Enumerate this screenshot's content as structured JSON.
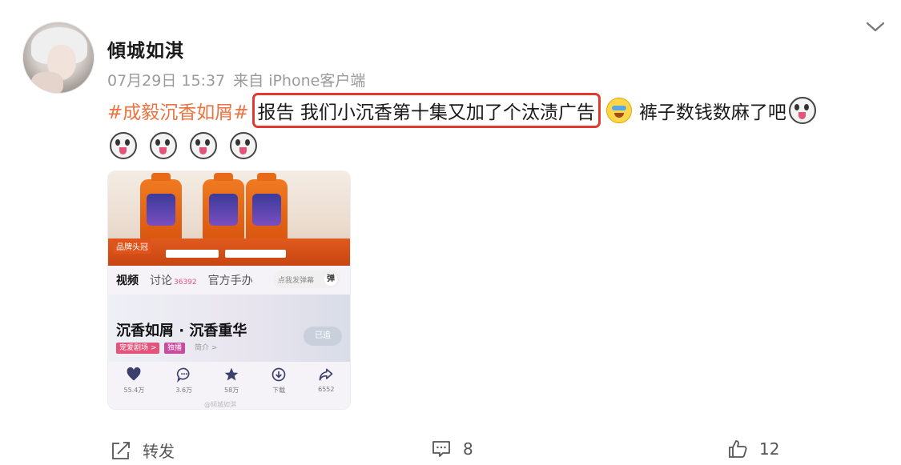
{
  "post": {
    "username": "傾城如淇",
    "date": "07月29日 15:37",
    "source": "来自 iPhone客户端",
    "hashtag": "#成毅沉香如屑#",
    "highlighted_text": "报告 我们小沉香第十集又加了个汰渍广告",
    "trailing_text": "裤子数钱数麻了吧"
  },
  "media": {
    "tabs": [
      {
        "label": "视频"
      },
      {
        "label": "讨论",
        "count": "36392"
      },
      {
        "label": "官方手办"
      }
    ],
    "danmu_placeholder": "点我发弹幕",
    "danmu_button": "弹",
    "show_title": "沉香如屑 · 沉香重华",
    "tags": [
      "宠爱剧场 >",
      "独播",
      "简介 >"
    ],
    "follow_label": "已追",
    "brand_tag": "品牌头冠",
    "actions": [
      {
        "icon": "heart-icon",
        "label": "55.4万"
      },
      {
        "icon": "comment-icon",
        "label": "3.6万"
      },
      {
        "icon": "star-icon",
        "label": "58万"
      },
      {
        "icon": "download-icon",
        "label": "下载"
      },
      {
        "icon": "share-icon",
        "label": "6552"
      }
    ],
    "watermark": "@倾城如淇"
  },
  "footer": {
    "repost_label": "转发",
    "comment_count": "8",
    "like_count": "12"
  },
  "colors": {
    "hashtag": "#eb7340",
    "highlight_border": "#e23a2e",
    "meta_text": "#9a9a9a"
  }
}
